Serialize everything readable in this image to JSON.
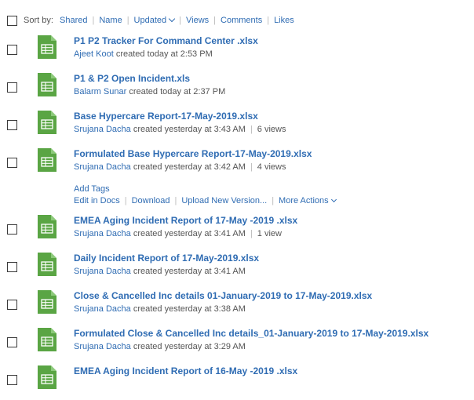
{
  "sort": {
    "label": "Sort by:",
    "options": [
      "Shared",
      "Name",
      "Updated",
      "Views",
      "Comments",
      "Likes"
    ]
  },
  "icons": {
    "file": "spreadsheet-file-icon",
    "color": "#5aa544"
  },
  "files": [
    {
      "title": "P1 P2 Tracker For Command Center .xlsx",
      "author": "Ajeet Koot",
      "created": "created today at 2:53 PM",
      "views": ""
    },
    {
      "title": "P1 & P2 Open Incident.xls",
      "author": "Balarm Sunar",
      "created": "created today at 2:37 PM",
      "views": ""
    },
    {
      "title": "Base Hypercare Report-17-May-2019.xlsx",
      "author": "Srujana Dacha",
      "created": "created yesterday at 3:43 AM",
      "views": "6 views"
    },
    {
      "title": "Formulated Base Hypercare Report-17-May-2019.xlsx",
      "author": "Srujana Dacha",
      "created": "created yesterday at 3:42 AM",
      "views": "4 views"
    },
    {
      "title": "EMEA Aging Incident Report of 17-May -2019 .xlsx",
      "author": "Srujana Dacha",
      "created": "created yesterday at 3:41 AM",
      "views": "1 view"
    },
    {
      "title": "Daily Incident Report of 17-May-2019.xlsx",
      "author": "Srujana Dacha",
      "created": "created yesterday at 3:41 AM",
      "views": ""
    },
    {
      "title": "Close & Cancelled Inc details 01-January-2019 to 17-May-2019.xlsx",
      "author": "Srujana Dacha",
      "created": "created yesterday at 3:38 AM",
      "views": ""
    },
    {
      "title": "Formulated Close & Cancelled Inc details_01-January-2019 to 17-May-2019.xlsx",
      "author": "Srujana Dacha",
      "created": "created yesterday at 3:29 AM",
      "views": ""
    },
    {
      "title": "EMEA Aging Incident Report of 16-May -2019 .xlsx",
      "author": "",
      "created": "",
      "views": ""
    }
  ],
  "hover_actions": {
    "add_tags": "Add Tags",
    "items": [
      "Edit in Docs",
      "Download",
      "Upload New Version...",
      "More Actions"
    ]
  }
}
